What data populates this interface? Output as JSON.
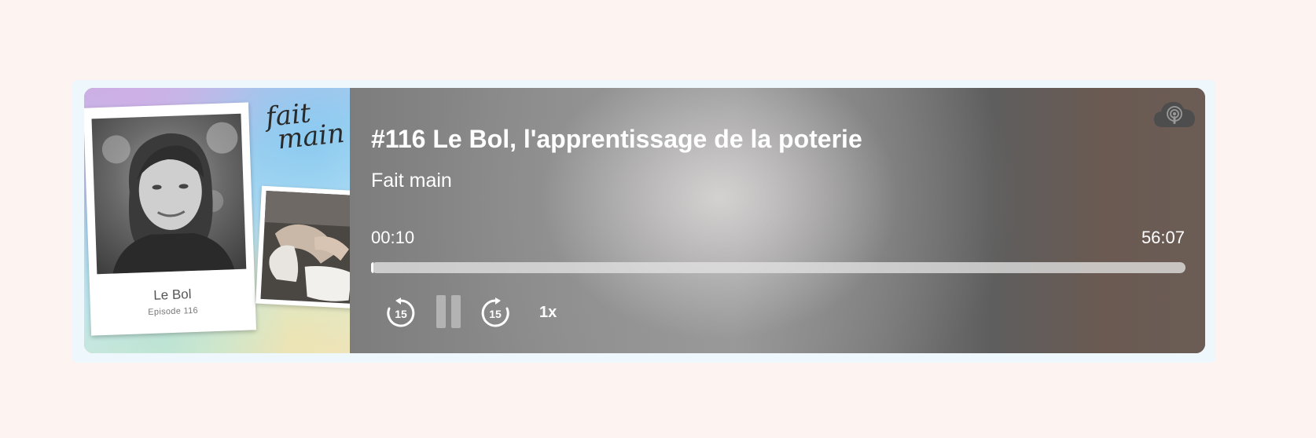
{
  "episode": {
    "title": "#116 Le Bol, l'apprentissage de la poterie",
    "show": "Fait main"
  },
  "cover": {
    "polaroid_name": "Le Bol",
    "polaroid_episode": "Episode 116",
    "logo_line1": "fait",
    "logo_line2": "main"
  },
  "playback": {
    "current_time": "00:10",
    "total_time": "56:07",
    "progress_fraction": 0.003,
    "speed_label": "1x",
    "skip_seconds": "15",
    "state": "playing"
  },
  "icons": {
    "top_right": "podcast-cloud-icon",
    "rewind": "rewind-15-icon",
    "pause": "pause-icon",
    "forward": "forward-15-icon"
  },
  "colors": {
    "page_background": "#fdf3f1",
    "frame": "#eef8fc",
    "text": "#ffffff"
  }
}
